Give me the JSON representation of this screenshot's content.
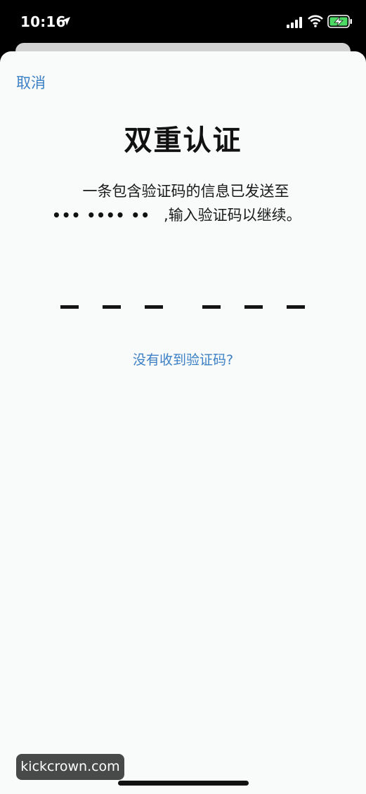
{
  "status_bar": {
    "time": "10:16",
    "icons": [
      "location-arrow-icon",
      "cellular-signal-icon",
      "wifi-icon",
      "battery-charging-icon"
    ]
  },
  "dialog": {
    "cancel_label": "取消",
    "title": "双重认证",
    "message_line1": "一条包含验证码的信息已发送至",
    "masked_number": "••• •••• ••",
    "separator": ",",
    "message_line2_tail": "输入验证码以继续。",
    "code_slots": 6,
    "resend_label": "没有收到验证码?"
  },
  "watermark": {
    "text": "kickcrown.com"
  },
  "colors": {
    "accent": "#3c80c6",
    "sheet_background": "#f9fafa",
    "status_background": "#000000",
    "battery_green": "#4cd964"
  }
}
